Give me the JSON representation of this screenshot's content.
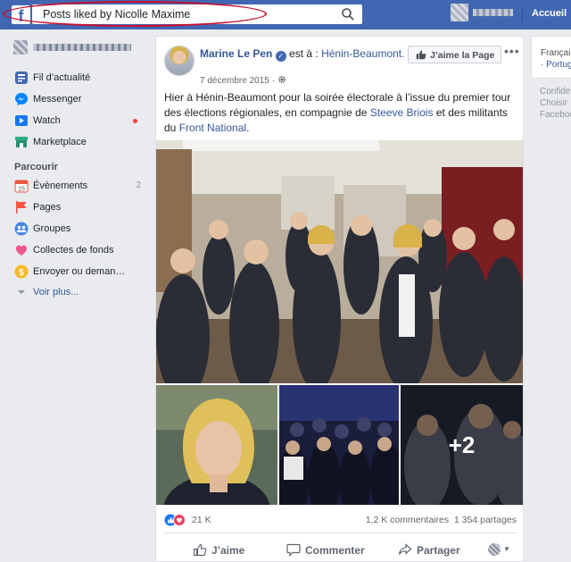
{
  "topbar": {
    "search_value": "Posts liked by Nicolle Maxime",
    "home_label": "Accueil"
  },
  "sidebar": {
    "items": [
      {
        "label": "Fil d’actualité",
        "icon": "news-feed-icon"
      },
      {
        "label": "Messenger",
        "icon": "messenger-icon"
      },
      {
        "label": "Watch",
        "icon": "watch-icon"
      },
      {
        "label": "Marketplace",
        "icon": "marketplace-icon"
      }
    ],
    "section_title": "Parcourir",
    "browse_items": [
      {
        "label": "Évènements",
        "count": "2",
        "icon": "calendar-icon"
      },
      {
        "label": "Pages",
        "icon": "flag-icon"
      },
      {
        "label": "Groupes",
        "icon": "groups-icon"
      },
      {
        "label": "Collectes de fonds",
        "icon": "fundraiser-icon"
      },
      {
        "label": "Envoyer ou deman…",
        "icon": "money-icon"
      }
    ],
    "see_more": "Voir plus..."
  },
  "post": {
    "author": "Marine Le Pen",
    "at_text": "est à :",
    "location": "Hénin-Beaumont.",
    "date": "7 décembre 2015 ·",
    "like_page_label": "J’aime la Page",
    "text_before": "Hier à Hénin-Beaumont pour la soirée électorale à l’issue du premier tour des élections régionales, en compagnie de",
    "link1": "Steeve Briois",
    "text_mid": "et des militants du",
    "link2": "Front National",
    "text_end": ".",
    "more_photos": "+2",
    "reaction_count": "21 K",
    "comments": "1,2 K commentaires",
    "shares": "1 354 partages",
    "actions": {
      "like": "J’aime",
      "comment": "Commenter",
      "share": "Partager"
    }
  },
  "right": {
    "lang1": "Françai",
    "lang2": "· Portug",
    "footer1": "Confide",
    "footer2": "Choisir",
    "footer3": "Faceboo"
  },
  "colors": {
    "brand_blue": "#4267b2",
    "link": "#365899",
    "annotation_red": "#c8102e"
  }
}
